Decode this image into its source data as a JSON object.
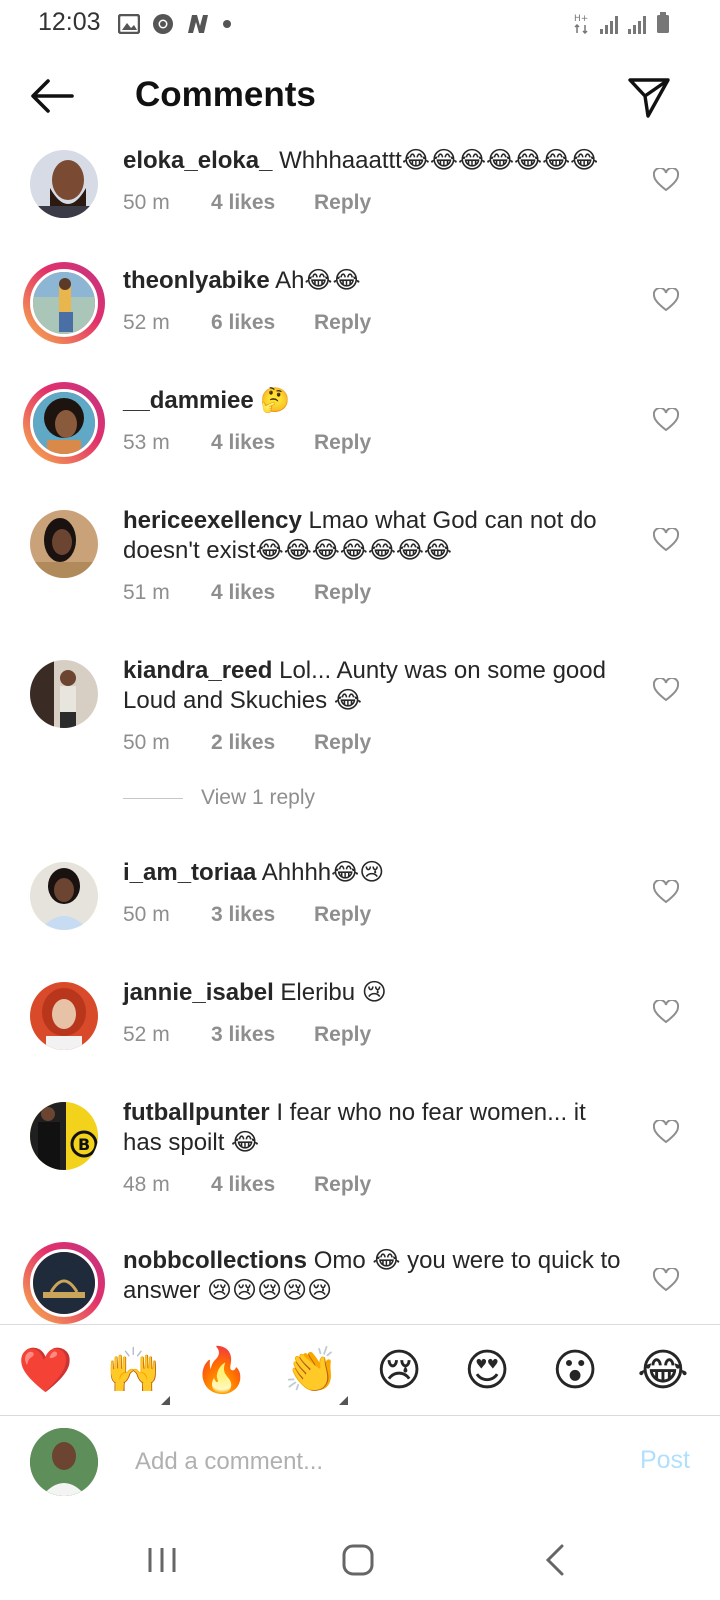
{
  "status_bar": {
    "time": "12:03",
    "left_icons": [
      "image-icon",
      "chrome-icon",
      "n-app-icon",
      "dot-icon"
    ],
    "right_icons": [
      "data-arrows-icon",
      "signal-icon",
      "signal-icon",
      "battery-icon"
    ]
  },
  "header": {
    "title": "Comments",
    "back_icon": "arrow-left-icon",
    "send_icon": "paper-plane-icon"
  },
  "comments": [
    {
      "username": "eloka_eloka_",
      "text": "Whhhaaattt😂😂😂😂😂😂😂",
      "time": "50 m",
      "likes": "4 likes",
      "reply": "Reply",
      "story_ring": false
    },
    {
      "username": "theonlyabike",
      "text": "Ah😂😂",
      "time": "52 m",
      "likes": "6 likes",
      "reply": "Reply",
      "story_ring": true
    },
    {
      "username": "__dammiee",
      "text": "🤔",
      "time": "53 m",
      "likes": "4 likes",
      "reply": "Reply",
      "story_ring": true
    },
    {
      "username": "hericeexellency",
      "text": "Lmao what God can not do doesn't exist😂😂😂😂😂😂😂",
      "time": "51 m",
      "likes": "4 likes",
      "reply": "Reply",
      "story_ring": false
    },
    {
      "username": "kiandra_reed",
      "text": "Lol... Aunty was on some good Loud and Skuchies 😂",
      "time": "50 m",
      "likes": "2 likes",
      "reply": "Reply",
      "story_ring": false
    },
    {
      "username": "i_am_toriaa",
      "text": "Ahhhh😂😢",
      "time": "50 m",
      "likes": "3 likes",
      "reply": "Reply",
      "story_ring": false
    },
    {
      "username": "jannie_isabel",
      "text": "Eleribu 😢",
      "time": "52 m",
      "likes": "3 likes",
      "reply": "Reply",
      "story_ring": false
    },
    {
      "username": "futballpunter",
      "text": "I fear who no fear women... it has spoilt 😂",
      "time": "48 m",
      "likes": "4 likes",
      "reply": "Reply",
      "story_ring": false
    },
    {
      "username": "nobbcollections",
      "text": "Omo 😂 you were to quick to answer 😢😢😢😢😢",
      "time": "",
      "likes": "",
      "reply": "",
      "story_ring": true
    }
  ],
  "view_replies": "View 1 reply",
  "emoji_bar": [
    {
      "glyph": "❤️",
      "name": "heart-emoji"
    },
    {
      "glyph": "🙌",
      "name": "raising-hands-emoji"
    },
    {
      "glyph": "🔥",
      "name": "fire-emoji"
    },
    {
      "glyph": "👏",
      "name": "clapping-emoji"
    },
    {
      "glyph": "😢",
      "name": "crying-emoji"
    },
    {
      "glyph": "😍",
      "name": "heart-eyes-emoji"
    },
    {
      "glyph": "😮",
      "name": "surprised-emoji"
    },
    {
      "glyph": "😂",
      "name": "tears-of-joy-emoji"
    }
  ],
  "composer": {
    "placeholder": "Add a comment...",
    "post_label": "Post"
  },
  "nav_bar": {
    "icons": [
      "recent-apps-icon",
      "home-icon",
      "back-icon"
    ]
  },
  "colors": {
    "post_disabled": "#b2dffc",
    "meta_gray": "#8e8e8e",
    "story_ring_start": "#f9b44b",
    "story_ring_end": "#c13584"
  }
}
